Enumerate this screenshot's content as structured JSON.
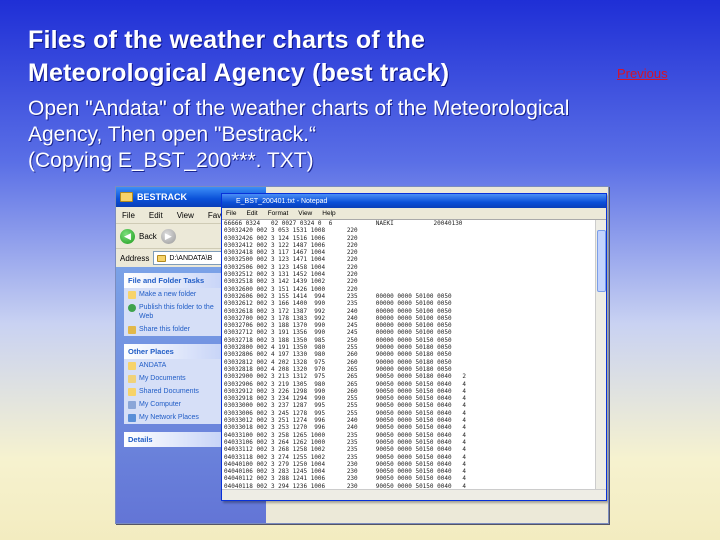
{
  "slide": {
    "title_line1": "Files of the weather charts of the",
    "title_line2": "Meteorological Agency (best track)",
    "previous_link": "Previous",
    "body_line1": "Open \"Andata\" of the weather charts of the Meteorological",
    "body_line2": "Agency,  Then open \"Bestrack.“",
    "body_line3": "(Copying E_BST_200***. TXT)"
  },
  "explorer": {
    "title": "BESTRACK",
    "menu": [
      "File",
      "Edit",
      "View",
      "Favor"
    ],
    "back_label": "Back",
    "address_label": "Address",
    "address_value": "D:\\ANDATA\\B",
    "tasks_header": "File and Folder Tasks",
    "tasks": [
      "Make a new folder",
      "Publish this folder to the Web",
      "Share this folder"
    ],
    "places_header": "Other Places",
    "places": [
      "ANDATA",
      "My Documents",
      "Shared Documents",
      "My Computer",
      "My Network Places"
    ],
    "details_header": "Details"
  },
  "notepad": {
    "title": "E_BST_200401.txt - Notepad",
    "menu": [
      "File",
      "Edit",
      "Format",
      "View",
      "Help"
    ],
    "lines": [
      "66666 0324   02 0027 0324 0  6            NAEKI           20040130",
      "03032420 002 3 053 1531 1008      220",
      "03032426 002 3 124 1516 1006      220",
      "03032412 002 3 122 1487 1006      220",
      "03032418 002 3 117 1467 1004      220",
      "03032500 002 3 123 1471 1004      220",
      "03032506 002 3 123 1458 1004      220",
      "03032512 002 3 131 1452 1004      220",
      "03032518 002 3 142 1439 1002      220",
      "03032600 002 3 151 1426 1000      220",
      "03032606 002 3 155 1414  994      235     00000 0000 50100 0050",
      "03032612 002 3 166 1400  990      235     00000 0000 50100 0050",
      "03032618 002 3 172 1387  992      240     00000 0000 50100 0050",
      "03032700 002 3 178 1383  992      240     00000 0000 50100 0050",
      "03032706 002 3 188 1370  990      245     00000 0000 50100 0050",
      "03032712 002 3 191 1356  990      245     00000 0000 50100 0050",
      "03032718 002 3 188 1350  985      250     00000 0000 50150 0050",
      "03032800 002 4 191 1350  980      255     90000 0000 50180 0050",
      "03032806 002 4 197 1330  980      260     90000 0000 50180 0050",
      "03032812 002 4 202 1328  975      260     90000 0000 50180 0050",
      "03032818 002 4 208 1320  970      265     90000 0000 50180 0050",
      "03032900 002 3 213 1312  975      265     90050 0000 50180 0040   2",
      "03032906 002 3 219 1305  980      265     90050 0000 50150 0040   4",
      "03032912 002 3 226 1298  990      260     90050 0000 50150 0040   4",
      "03032918 002 3 234 1294  990      255     90050 0000 50150 0040   4",
      "03033000 002 3 237 1287  995      255     90050 0000 50150 0040   4",
      "03033006 002 3 245 1278  995      255     90050 0000 50150 0040   4",
      "03033012 002 3 251 1274  996      240     90050 0000 50150 0040   4",
      "03033018 002 3 253 1270  996      240     90050 0000 50150 0040   4",
      "04033100 002 3 258 1265 1000      235     90050 0000 50150 0040   4",
      "04033106 002 3 264 1262 1000      235     90050 0000 50150 0040   4",
      "04033112 002 3 268 1258 1002      235     90050 0000 50150 0040   4",
      "04033118 002 3 274 1255 1002      235     90050 0000 50150 0040   4",
      "04040100 002 3 279 1250 1004      230     90050 0000 50150 0040   4",
      "04040106 002 3 283 1245 1004      230     90050 0000 50150 0040   4",
      "04040112 002 3 288 1241 1006      230     90050 0000 50150 0040   4",
      "04040118 002 3 294 1236 1006      230     90050 0000 50150 0040   4",
      "04040200 002 3 299 1230 1008      230     90050 0000 50150 0040   4",
      "04040206 002 3 305 1226 1008      230     90050 0000 50150 0040   4",
      "04040212 002 3 309 1220 1008      230     90050 0000 50150 0040   4",
      "04040218 002 3 315 1214 1008      230     90050 0000 50150 0040   4"
    ]
  },
  "colors": {
    "title_text": "#ffffff",
    "previous_link": "#d6122a",
    "xp_blue": "#0a50d8",
    "taskpane": "#7ba2e7"
  }
}
